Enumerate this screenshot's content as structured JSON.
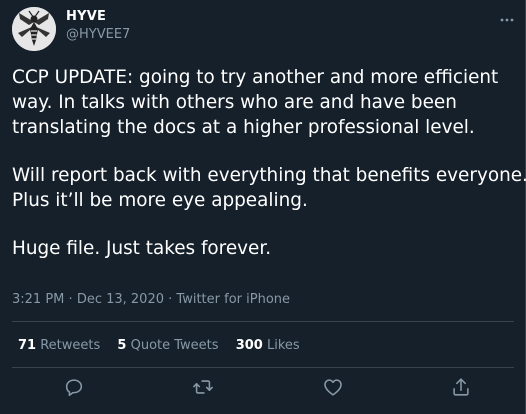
{
  "author": {
    "name": "HYVE",
    "handle": "@HYVEE7"
  },
  "tweet": {
    "paragraph_1": [
      "CCP UPDATE: going to try another and more efficient",
      "way. In talks with others who are and have been",
      "translating the docs at a higher professional level."
    ],
    "paragraph_2": [
      "Will report back with everything that benefits everyone.",
      "Plus it’ll be more eye appealing."
    ],
    "paragraph_3": [
      "Huge file. Just takes forever."
    ],
    "time": "3:21 PM",
    "date": "Dec 13, 2020",
    "source": "Twitter for iPhone",
    "separator": "·"
  },
  "stats": {
    "retweets_count": "71",
    "retweets_label": "Retweets",
    "quotes_count": "5",
    "quotes_label": "Quote Tweets",
    "likes_count": "300",
    "likes_label": "Likes"
  },
  "icons": {
    "avatar": "hornet-logo",
    "more": "more-icon",
    "reply": "reply-icon",
    "retweet": "retweet-icon",
    "like": "like-icon",
    "share": "share-icon"
  },
  "colors": {
    "background": "#15202b",
    "text": "#ffffff",
    "secondary": "#8899a6",
    "divider": "#38444d"
  }
}
